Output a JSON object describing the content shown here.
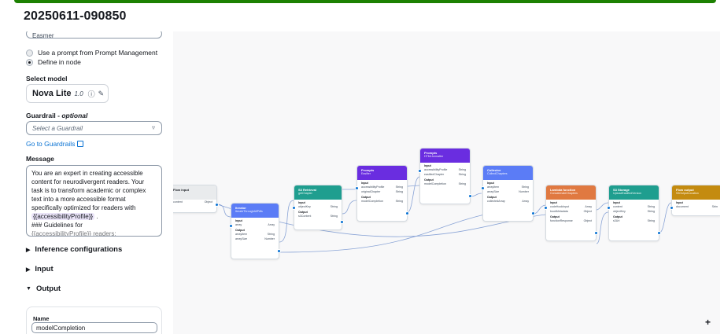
{
  "header": {
    "title": "20250611-090850"
  },
  "panel": {
    "top_field_value": "Easmer",
    "prompt_source": {
      "options": [
        "Use a prompt from Prompt Management",
        "Define in node"
      ],
      "selected": "Define in node"
    },
    "select_model_label": "Select model",
    "model": {
      "name": "Nova Lite",
      "version": "1.0"
    },
    "guardrail_label": "Guardrail - ",
    "guardrail_optional": "optional",
    "guardrail_placeholder": "Select a Guardrail",
    "guardrails_link": "Go to Guardrails",
    "message_label": "Message",
    "message_lines": [
      "You are an expert in creating accessible",
      "content for neurodivergent readers. Your",
      "task is to transform academic or complex",
      "text into a more accessible format",
      "specifically optimized for readers with"
    ],
    "message_chip": "{{accessibilityProfile}}",
    "message_after_chip": ".",
    "message_heading": "### Guidelines for",
    "message_tail": "{{accessibilityProfile}} readers:",
    "sections": {
      "inference": "Inference configurations",
      "input": "Input",
      "output": "Output"
    },
    "output_name_label": "Name",
    "output_name_value": "modelCompletion"
  },
  "canvas": {
    "zoom_plus": "+",
    "nodes": [
      {
        "title": "Flow input",
        "subtitle": "",
        "color": "#e9ebed",
        "dark": true,
        "rows": [
          [
            "content",
            "Object"
          ]
        ]
      },
      {
        "title": "Iterator",
        "subtitle": "IterateThroughAllPdfs",
        "color": "#5b7cf6",
        "rows": [
          [
            "Input",
            ""
          ],
          [
            "array",
            "Array"
          ],
          [
            "Output",
            ""
          ],
          [
            "arrayItem",
            "String"
          ],
          [
            "arraySize",
            "Number"
          ]
        ]
      },
      {
        "title": "S3 Retrieval",
        "subtitle": "getChapter",
        "color": "#1f9e8f",
        "rows": [
          [
            "Input",
            ""
          ],
          [
            "objectKey",
            "String"
          ],
          [
            "Output",
            ""
          ],
          [
            "s3Content",
            "String"
          ]
        ]
      },
      {
        "title": "Prompts",
        "subtitle": "Easifier",
        "color": "#6a2de0",
        "rows": [
          [
            "Input",
            ""
          ],
          [
            "accessibilityProfile",
            "String"
          ],
          [
            "originalChapter",
            "String"
          ],
          [
            "Output",
            ""
          ],
          [
            "modelCompletion",
            "String"
          ]
        ]
      },
      {
        "title": "Prompts",
        "subtitle": "HTMLformatter",
        "color": "#6a2de0",
        "rows": [
          [
            "Input",
            ""
          ],
          [
            "accessibilityProfile",
            "String"
          ],
          [
            "easifiedChapter",
            "String"
          ],
          [
            "Output",
            ""
          ],
          [
            "modelCompletion",
            "String"
          ]
        ]
      },
      {
        "title": "Collector",
        "subtitle": "CollectChapters",
        "color": "#5b7cf6",
        "rows": [
          [
            "Input",
            ""
          ],
          [
            "arrayItem",
            "String"
          ],
          [
            "arraySize",
            "Number"
          ],
          [
            "Output",
            ""
          ],
          [
            "collectedArray",
            "Array"
          ]
        ]
      },
      {
        "title": "Lambda function",
        "subtitle": "ConcatenateChapters",
        "color": "#e07941",
        "rows": [
          [
            "Input",
            ""
          ],
          [
            "codeHookInput",
            "Array"
          ],
          [
            "bookMetadata",
            "Object"
          ],
          [
            "Output",
            ""
          ],
          [
            "functionResponse",
            "Object"
          ]
        ]
      },
      {
        "title": "S3 Storage",
        "subtitle": "UploadEasifiedVersion",
        "color": "#1f9e8f",
        "rows": [
          [
            "Input",
            ""
          ],
          [
            "content",
            "String"
          ],
          [
            "objectKey",
            "String"
          ],
          [
            "Output",
            ""
          ],
          [
            "s3Uri",
            "String"
          ]
        ]
      },
      {
        "title": "Flow output",
        "subtitle": "S3OutputLocation",
        "color": "#c48b10",
        "rows": [
          [
            "Input",
            ""
          ],
          [
            "document",
            "Strin"
          ]
        ]
      }
    ]
  },
  "colors": {
    "accent": "#0972d3",
    "success_bar": "#1d8102"
  }
}
